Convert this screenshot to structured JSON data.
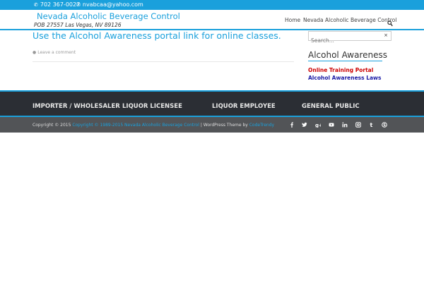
{
  "topbar": {
    "phone": "702 367-0027",
    "email": "nvabcaa@yahoo.com",
    "phone_icon": "phone-icon",
    "email_icon": "envelope-icon"
  },
  "header": {
    "site_title": "Nevada Alcoholic Beverage Control",
    "site_description": "POB 27557 Las Vegas, NV 89126",
    "nav": [
      {
        "label": "Home"
      },
      {
        "label": "Nevada Alcoholic Beverage Control"
      }
    ],
    "search_icon": "search-icon"
  },
  "post": {
    "title": "Use the Alcohol Awareness portal link for online classes.",
    "comment_link": "Leave a comment",
    "comment_icon": "comment-icon"
  },
  "sidebar": {
    "search_placeholder": "Search...",
    "search_clear": "×",
    "widget_title": "Alcohol Awareness",
    "links": [
      {
        "label": "Online Training Portal",
        "color": "#cc0000"
      },
      {
        "label": "Alcohol Awareness Laws",
        "color": "#1a1aa6"
      }
    ]
  },
  "footer_widgets": [
    {
      "label": "IMPORTER / WHOLESALER"
    },
    {
      "label": "LIQUOR LICENSEE"
    },
    {
      "label": "LIQUOR EMPLOYEE"
    },
    {
      "label": "GENERAL PUBLIC"
    }
  ],
  "bottom": {
    "copyright_prefix": "Copyright © 2015 ",
    "copyright_link": "Copyright © 1989-2015 Nevada Alcoholic Beverage Control",
    "theme_text": " | WordPress Theme by ",
    "theme_link": "CodeTrendy",
    "social_icons": [
      "facebook-icon",
      "twitter-icon",
      "google-plus-icon",
      "youtube-icon",
      "linkedin-icon",
      "instagram-icon",
      "tumblr-icon",
      "skype-icon"
    ]
  },
  "colors": {
    "accent": "#1aa0dc",
    "footer_dark": "#2b2e34",
    "bottom_bar": "#525457"
  }
}
